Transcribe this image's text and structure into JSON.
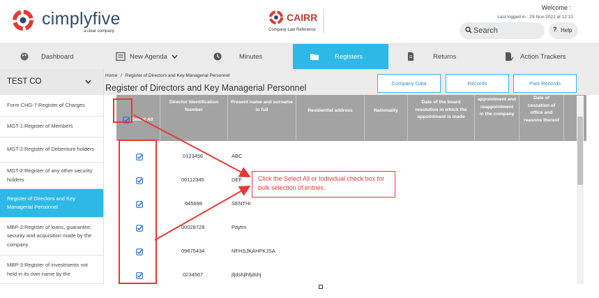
{
  "header": {
    "brand": "cimplyfive",
    "brand_sub": "a clear company",
    "cairr_title": "CAIRR",
    "cairr_sub": "Company Law Reference",
    "welcome": "Welcome :",
    "last_logged": "Last logged in : 29-Nov-2022 at 12:10",
    "search_label": "Search",
    "help_label": "Help",
    "help_icon": "?"
  },
  "colors": {
    "accent": "#2eb8e6",
    "brand_red": "#e53935",
    "header_grey": "#a3a3a3",
    "annotation": "#e53935"
  },
  "nav": {
    "items": [
      {
        "label": "Dashboard",
        "icon": "palette-icon"
      },
      {
        "label": "New Agenda",
        "icon": "list-icon"
      },
      {
        "label": "Minutes",
        "icon": "clock-icon"
      },
      {
        "label": "Registers",
        "icon": "folder-icon"
      },
      {
        "label": "Returns",
        "icon": "document-icon"
      },
      {
        "label": "Action Trackers",
        "icon": "tracker-icon"
      }
    ],
    "active": "Registers"
  },
  "sidebar": {
    "company": "TEST CO",
    "items": [
      {
        "label": "Form CHG-7:Register of Charges"
      },
      {
        "label": "MGT-1:Register of Members"
      },
      {
        "label": "MGT-2:Register of Debenture holders"
      },
      {
        "label": "MGT-2:Register of any other security holders"
      },
      {
        "label": "Register of Directors and Key Managerial Personnel"
      },
      {
        "label": "MBP-2:Register of loans, guarantee, security and acquisition made by the company"
      },
      {
        "label": "MBP-3:Register of investments not held in its own name by the"
      }
    ]
  },
  "main": {
    "breadcrumb_home": "Home",
    "breadcrumb_sep": "/",
    "breadcrumb_current": "Register of Directors and Key Managerial Personnel",
    "title": "Register of Directors and Key Managerial Personnel",
    "buttons": {
      "company_data": "Company Data",
      "records": "Records",
      "past_records": "Past Records"
    }
  },
  "table": {
    "headers": {
      "select_all": "Select All",
      "din": "Director Identification Number",
      "name": "Present name and surname in full",
      "address": "Residential address",
      "nationality": "Nationality",
      "board_resolution": "Date of the board resolution in which the appointment is made",
      "appointment": "appointment and reappointment in the company",
      "cessation": "Date of cessation of office and reasons thereof"
    },
    "rows": [
      {
        "din": "0123456",
        "name": "ABC"
      },
      {
        "din": "00112345",
        "name": "DEF"
      },
      {
        "din": "045698",
        "name": "SENTHI"
      },
      {
        "din": "00028728",
        "name": "Paytm"
      },
      {
        "din": "09875434",
        "name": "NFHSJKAHFKJSA"
      },
      {
        "din": "0234567",
        "name": "jfjdshjlhfjdshj"
      }
    ]
  },
  "annotation": {
    "text": "Click the Select All or Individual check box for bulk selection of entries."
  }
}
